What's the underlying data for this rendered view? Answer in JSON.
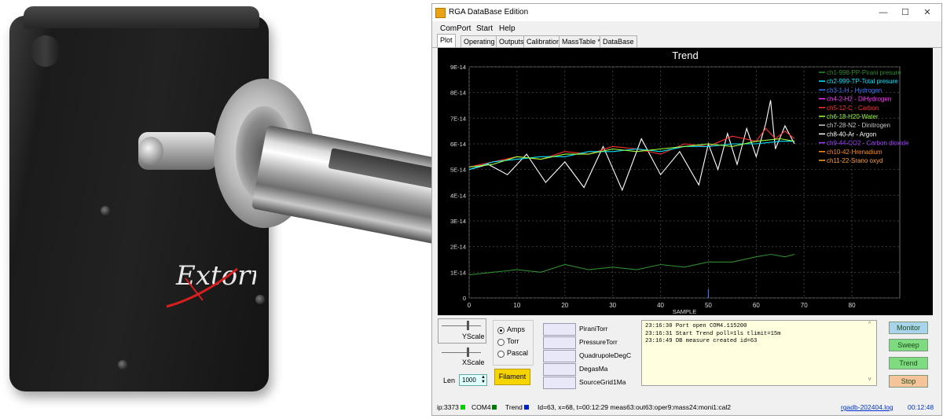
{
  "window": {
    "title": "RGA DataBase Edition",
    "controls": {
      "minimize": "—",
      "maximize": "☐",
      "close": "✕"
    }
  },
  "menu": [
    "ComPort",
    "Start",
    "Help"
  ],
  "tabs": [
    "Plot",
    "Operating",
    "Outputs",
    "Calibration",
    "MassTable **",
    "DataBase"
  ],
  "device": {
    "logo": "Extorr"
  },
  "chart_data": {
    "type": "line",
    "title": "Trend",
    "xlabel": "SAMPLE",
    "ylabel": "",
    "xlim": [
      0,
      90
    ],
    "ylim": [
      0,
      9e-14
    ],
    "x_ticks": [
      "0",
      "10",
      "20",
      "30",
      "40",
      "50",
      "60",
      "70",
      "80"
    ],
    "y_ticks": [
      "0",
      "1E-14",
      "2E-14",
      "3E-14",
      "4E-14",
      "5E-14",
      "6E-14",
      "7E-14",
      "8E-14",
      "9E-14"
    ],
    "grid": true,
    "legend_position": "top-right",
    "legend": [
      {
        "name": "ch1-998-PP-Pirani presure",
        "color": "#2e8b2e"
      },
      {
        "name": "ch2-999-TP-Total presure",
        "color": "#00e5ff"
      },
      {
        "name": "ch3-1-H - Hydrogen",
        "color": "#3a7bff"
      },
      {
        "name": "ch4-2-H2 - DiHydrogen",
        "color": "#ff33ff"
      },
      {
        "name": "ch5-12-C - Carbon",
        "color": "#ff3030"
      },
      {
        "name": "ch6-18-H20-Water",
        "color": "#9dff3d"
      },
      {
        "name": "ch7-28-N2 - Dinitrogen",
        "color": "#c8c8c8"
      },
      {
        "name": "ch8-40-Ar - Argon",
        "color": "#ffffff"
      },
      {
        "name": "ch9-44-CO2 - Carbon dioxide",
        "color": "#a040ff"
      },
      {
        "name": "ch10-42-Hrenadium",
        "color": "#ff8c1a"
      },
      {
        "name": "ch11-22-Srano oxyd",
        "color": "#ffa030"
      }
    ],
    "series": [
      {
        "name": "ch8-40-Ar - Argon",
        "color": "#ffffff",
        "x": [
          0,
          4,
          8,
          12,
          16,
          20,
          24,
          28,
          32,
          36,
          40,
          44,
          48,
          50,
          52,
          54,
          56,
          58,
          60,
          62,
          63,
          64,
          66,
          68
        ],
        "y": [
          5e-14,
          5.2e-14,
          4.8e-14,
          5.6e-14,
          4.5e-14,
          5.3e-14,
          4.3e-14,
          5.9e-14,
          4.2e-14,
          6.2e-14,
          4.8e-14,
          5.7e-14,
          4.4e-14,
          6e-14,
          5e-14,
          6.4e-14,
          5.2e-14,
          6.6e-14,
          5.5e-14,
          6.8e-14,
          7.7e-14,
          5.8e-14,
          6.7e-14,
          6e-14
        ]
      },
      {
        "name": "ch5-12-C - Carbon",
        "color": "#ff3030",
        "x": [
          0,
          5,
          10,
          15,
          20,
          25,
          30,
          35,
          40,
          45,
          50,
          55,
          60,
          62,
          64,
          66,
          68
        ],
        "y": [
          5.1e-14,
          5.3e-14,
          5.5e-14,
          5.4e-14,
          5.7e-14,
          5.6e-14,
          5.9e-14,
          5.8e-14,
          5.6e-14,
          6e-14,
          5.9e-14,
          6.3e-14,
          6.1e-14,
          6.6e-14,
          6.2e-14,
          6.5e-14,
          6.2e-14
        ]
      },
      {
        "name": "ch2-999-TP-Total presure",
        "color": "#00e5ff",
        "x": [
          0,
          5,
          10,
          15,
          20,
          25,
          30,
          35,
          40,
          45,
          50,
          55,
          60,
          65,
          68
        ],
        "y": [
          5e-14,
          5.3e-14,
          5.4e-14,
          5.5e-14,
          5.5e-14,
          5.7e-14,
          5.7e-14,
          5.8e-14,
          5.7e-14,
          5.9e-14,
          5.9e-14,
          6e-14,
          6e-14,
          6.1e-14,
          6.1e-14
        ]
      },
      {
        "name": "ch6-18-H20-Water",
        "color": "#9dff3d",
        "x": [
          0,
          5,
          10,
          15,
          20,
          25,
          30,
          35,
          40,
          45,
          50,
          55,
          60,
          65,
          68
        ],
        "y": [
          5.1e-14,
          5.2e-14,
          5.5e-14,
          5.4e-14,
          5.6e-14,
          5.6e-14,
          5.8e-14,
          5.7e-14,
          5.8e-14,
          5.9e-14,
          6e-14,
          5.9e-14,
          6.1e-14,
          6.2e-14,
          6.1e-14
        ]
      },
      {
        "name": "ch1-998-PP-Pirani presure",
        "color": "#2e8b2e",
        "x": [
          0,
          5,
          10,
          15,
          20,
          25,
          30,
          35,
          40,
          45,
          50,
          55,
          60,
          63,
          66,
          68
        ],
        "y": [
          9e-15,
          1e-14,
          1.1e-14,
          1e-14,
          1.3e-14,
          1.1e-14,
          1.2e-14,
          1.1e-14,
          1.3e-14,
          1.2e-14,
          1.4e-14,
          1.4e-14,
          1.6e-14,
          1.7e-14,
          1.6e-14,
          1.7e-14
        ]
      },
      {
        "name": "ch3-1-H - Hydrogen",
        "color": "#3a7bff",
        "x": [
          50,
          50
        ],
        "y": [
          0,
          3.5e-15
        ]
      }
    ]
  },
  "controls": {
    "yscale_label": "YScale",
    "xscale_label": "XScale",
    "len_label": "Len",
    "len_value": "1000",
    "units": [
      {
        "label": "Amps",
        "selected": true
      },
      {
        "label": "Torr",
        "selected": false
      },
      {
        "label": "Pascal",
        "selected": false
      }
    ],
    "filament_button": "Filament",
    "sensors": [
      "PiraniTorr",
      "PressureTorr",
      "QuadrupoleDegC",
      "DegasMa",
      "SourceGrid1Ma"
    ]
  },
  "log": [
    "23:16:30 Port open COM4.115200",
    "23:16:31 Start Trend poll=1ls tlimit=15m",
    "23:16:49 DB measure created id=63"
  ],
  "actions": [
    {
      "label": "Monitor",
      "bg": "#a9d4ec"
    },
    {
      "label": "Sweep",
      "bg": "#7fdb7f"
    },
    {
      "label": "Trend",
      "bg": "#7fdb7f"
    },
    {
      "label": "Stop",
      "bg": "#f6c49a"
    }
  ],
  "status": {
    "ip": "ip:3373",
    "com": "COM4",
    "mode": "Trend",
    "info": "Id=63, x=68, t=00:12:29  meas63:out63:oper9:mass24:moni1:cal2",
    "logfile": "rgadb-202404.log",
    "elapsed": "00:12:48"
  }
}
